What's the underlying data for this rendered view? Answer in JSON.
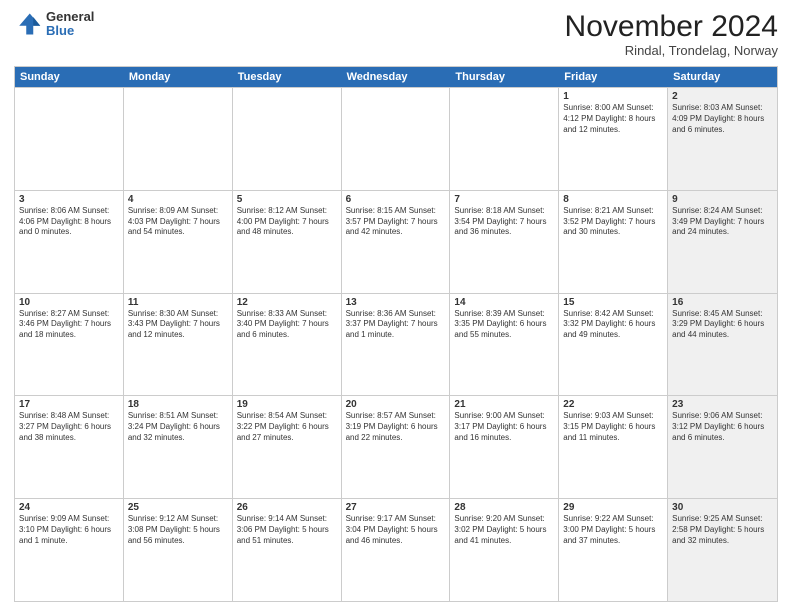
{
  "logo": {
    "general": "General",
    "blue": "Blue"
  },
  "header": {
    "month": "November 2024",
    "location": "Rindal, Trondelag, Norway"
  },
  "weekdays": [
    "Sunday",
    "Monday",
    "Tuesday",
    "Wednesday",
    "Thursday",
    "Friday",
    "Saturday"
  ],
  "rows": [
    [
      {
        "day": "",
        "info": "",
        "shaded": false
      },
      {
        "day": "",
        "info": "",
        "shaded": false
      },
      {
        "day": "",
        "info": "",
        "shaded": false
      },
      {
        "day": "",
        "info": "",
        "shaded": false
      },
      {
        "day": "",
        "info": "",
        "shaded": false
      },
      {
        "day": "1",
        "info": "Sunrise: 8:00 AM\nSunset: 4:12 PM\nDaylight: 8 hours\nand 12 minutes.",
        "shaded": false
      },
      {
        "day": "2",
        "info": "Sunrise: 8:03 AM\nSunset: 4:09 PM\nDaylight: 8 hours\nand 6 minutes.",
        "shaded": true
      }
    ],
    [
      {
        "day": "3",
        "info": "Sunrise: 8:06 AM\nSunset: 4:06 PM\nDaylight: 8 hours\nand 0 minutes.",
        "shaded": false
      },
      {
        "day": "4",
        "info": "Sunrise: 8:09 AM\nSunset: 4:03 PM\nDaylight: 7 hours\nand 54 minutes.",
        "shaded": false
      },
      {
        "day": "5",
        "info": "Sunrise: 8:12 AM\nSunset: 4:00 PM\nDaylight: 7 hours\nand 48 minutes.",
        "shaded": false
      },
      {
        "day": "6",
        "info": "Sunrise: 8:15 AM\nSunset: 3:57 PM\nDaylight: 7 hours\nand 42 minutes.",
        "shaded": false
      },
      {
        "day": "7",
        "info": "Sunrise: 8:18 AM\nSunset: 3:54 PM\nDaylight: 7 hours\nand 36 minutes.",
        "shaded": false
      },
      {
        "day": "8",
        "info": "Sunrise: 8:21 AM\nSunset: 3:52 PM\nDaylight: 7 hours\nand 30 minutes.",
        "shaded": false
      },
      {
        "day": "9",
        "info": "Sunrise: 8:24 AM\nSunset: 3:49 PM\nDaylight: 7 hours\nand 24 minutes.",
        "shaded": true
      }
    ],
    [
      {
        "day": "10",
        "info": "Sunrise: 8:27 AM\nSunset: 3:46 PM\nDaylight: 7 hours\nand 18 minutes.",
        "shaded": false
      },
      {
        "day": "11",
        "info": "Sunrise: 8:30 AM\nSunset: 3:43 PM\nDaylight: 7 hours\nand 12 minutes.",
        "shaded": false
      },
      {
        "day": "12",
        "info": "Sunrise: 8:33 AM\nSunset: 3:40 PM\nDaylight: 7 hours\nand 6 minutes.",
        "shaded": false
      },
      {
        "day": "13",
        "info": "Sunrise: 8:36 AM\nSunset: 3:37 PM\nDaylight: 7 hours\nand 1 minute.",
        "shaded": false
      },
      {
        "day": "14",
        "info": "Sunrise: 8:39 AM\nSunset: 3:35 PM\nDaylight: 6 hours\nand 55 minutes.",
        "shaded": false
      },
      {
        "day": "15",
        "info": "Sunrise: 8:42 AM\nSunset: 3:32 PM\nDaylight: 6 hours\nand 49 minutes.",
        "shaded": false
      },
      {
        "day": "16",
        "info": "Sunrise: 8:45 AM\nSunset: 3:29 PM\nDaylight: 6 hours\nand 44 minutes.",
        "shaded": true
      }
    ],
    [
      {
        "day": "17",
        "info": "Sunrise: 8:48 AM\nSunset: 3:27 PM\nDaylight: 6 hours\nand 38 minutes.",
        "shaded": false
      },
      {
        "day": "18",
        "info": "Sunrise: 8:51 AM\nSunset: 3:24 PM\nDaylight: 6 hours\nand 32 minutes.",
        "shaded": false
      },
      {
        "day": "19",
        "info": "Sunrise: 8:54 AM\nSunset: 3:22 PM\nDaylight: 6 hours\nand 27 minutes.",
        "shaded": false
      },
      {
        "day": "20",
        "info": "Sunrise: 8:57 AM\nSunset: 3:19 PM\nDaylight: 6 hours\nand 22 minutes.",
        "shaded": false
      },
      {
        "day": "21",
        "info": "Sunrise: 9:00 AM\nSunset: 3:17 PM\nDaylight: 6 hours\nand 16 minutes.",
        "shaded": false
      },
      {
        "day": "22",
        "info": "Sunrise: 9:03 AM\nSunset: 3:15 PM\nDaylight: 6 hours\nand 11 minutes.",
        "shaded": false
      },
      {
        "day": "23",
        "info": "Sunrise: 9:06 AM\nSunset: 3:12 PM\nDaylight: 6 hours\nand 6 minutes.",
        "shaded": true
      }
    ],
    [
      {
        "day": "24",
        "info": "Sunrise: 9:09 AM\nSunset: 3:10 PM\nDaylight: 6 hours\nand 1 minute.",
        "shaded": false
      },
      {
        "day": "25",
        "info": "Sunrise: 9:12 AM\nSunset: 3:08 PM\nDaylight: 5 hours\nand 56 minutes.",
        "shaded": false
      },
      {
        "day": "26",
        "info": "Sunrise: 9:14 AM\nSunset: 3:06 PM\nDaylight: 5 hours\nand 51 minutes.",
        "shaded": false
      },
      {
        "day": "27",
        "info": "Sunrise: 9:17 AM\nSunset: 3:04 PM\nDaylight: 5 hours\nand 46 minutes.",
        "shaded": false
      },
      {
        "day": "28",
        "info": "Sunrise: 9:20 AM\nSunset: 3:02 PM\nDaylight: 5 hours\nand 41 minutes.",
        "shaded": false
      },
      {
        "day": "29",
        "info": "Sunrise: 9:22 AM\nSunset: 3:00 PM\nDaylight: 5 hours\nand 37 minutes.",
        "shaded": false
      },
      {
        "day": "30",
        "info": "Sunrise: 9:25 AM\nSunset: 2:58 PM\nDaylight: 5 hours\nand 32 minutes.",
        "shaded": true
      }
    ]
  ]
}
